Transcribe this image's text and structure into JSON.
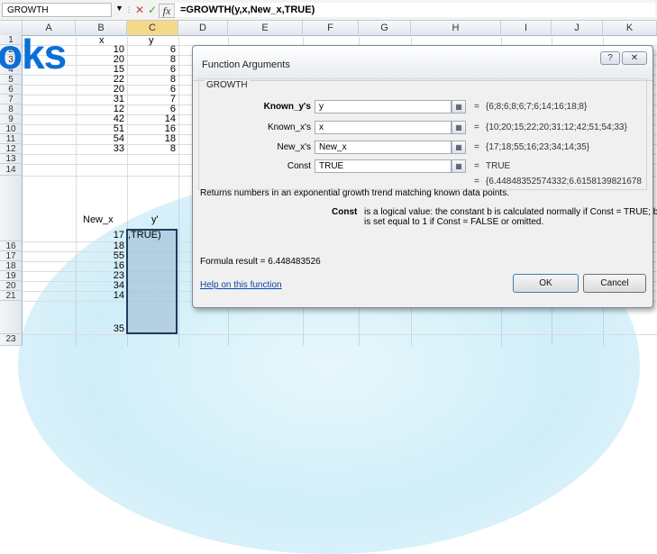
{
  "formula_bar": {
    "name_box": "GROWTH",
    "cancel_glyph": "✕",
    "enter_glyph": "✓",
    "fx_label": "fx",
    "formula": "=GROWTH(y,x,New_x,TRUE)"
  },
  "columns": [
    "A",
    "B",
    "C",
    "D",
    "E",
    "F",
    "G",
    "H",
    "I",
    "J",
    "K"
  ],
  "rows": [
    "1",
    "2",
    "3",
    "4",
    "5",
    "6",
    "7",
    "8",
    "9",
    "10",
    "11",
    "12",
    "13",
    "14",
    "",
    "16",
    "17",
    "18",
    "19",
    "20",
    "21",
    "",
    "23"
  ],
  "cells": {
    "b1": "x",
    "c1": "y",
    "b2": "10",
    "c2": "6",
    "b3": "20",
    "c3": "8",
    "b4": "15",
    "c4": "6",
    "b5": "22",
    "c5": "8",
    "b6": "20",
    "c6": "6",
    "b7": "31",
    "c7": "7",
    "b8": "12",
    "c8": "6",
    "b9": "42",
    "c9": "14",
    "b10": "51",
    "c10": "16",
    "b11": "54",
    "c11": "18",
    "b12": "33",
    "c12": "8",
    "b14": "New_x",
    "c14": "y'",
    "b15": "17",
    "c15": ",TRUE)",
    "b16": "18",
    "b17": "55",
    "b18": "16",
    "b19": "23",
    "b20": "34",
    "b21": "14",
    "b22": "35"
  },
  "watermark": {
    "text": "oks"
  },
  "dialog": {
    "title": "Function Arguments",
    "help_glyph": "?",
    "close_glyph": "✕",
    "function_name": "GROWTH",
    "args": [
      {
        "label": "Known_y's",
        "input": "y",
        "result": "{6;8;6;8;6;7;6;14;16;18;8}",
        "bold": true
      },
      {
        "label": "Known_x's",
        "input": "x",
        "result": "{10;20;15;22;20;31;12;42;51;54;33}",
        "bold": false
      },
      {
        "label": "New_x's",
        "input": "New_x",
        "result": "{17;18;55;16;23;34;14;35}",
        "bold": false
      },
      {
        "label": "Const",
        "input": "TRUE",
        "result": "TRUE",
        "bold": false
      }
    ],
    "equals": "=",
    "result_preview": "{6.44848352574332;6.6158139821678",
    "description": "Returns numbers in an exponential growth trend matching known data points.",
    "const_label": "Const",
    "const_desc_line1": "is a logical value: the constant b is calculated normally if Const = TRUE; b",
    "const_desc_line2": "is set equal to 1 if Const = FALSE or omitted.",
    "formula_result": "Formula result =  6.448483526",
    "help_link": "Help on this function",
    "ok": "OK",
    "cancel": "Cancel"
  }
}
